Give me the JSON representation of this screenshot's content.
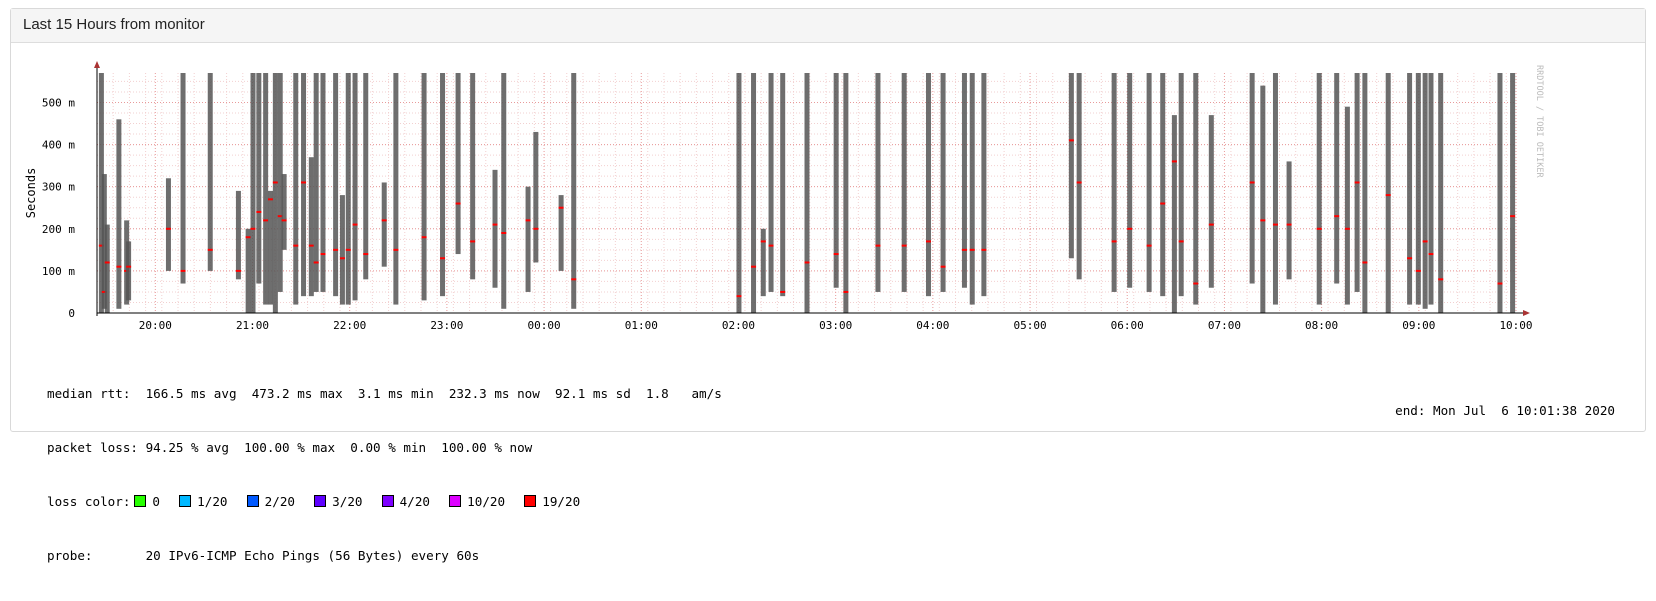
{
  "panel": {
    "title": "Last 15 Hours from monitor"
  },
  "chart_data": {
    "type": "bar",
    "ylabel": "Seconds",
    "watermark": "RRDTOOL / TOBI OETIKER",
    "y_ticks": [
      {
        "value": 0,
        "label": "0"
      },
      {
        "value": 0.1,
        "label": "100 m"
      },
      {
        "value": 0.2,
        "label": "200 m"
      },
      {
        "value": 0.3,
        "label": "300 m"
      },
      {
        "value": 0.4,
        "label": "400 m"
      },
      {
        "value": 0.5,
        "label": "500 m"
      }
    ],
    "ylim": [
      0,
      0.57
    ],
    "x_ticks": [
      "20:00",
      "21:00",
      "22:00",
      "23:00",
      "00:00",
      "01:00",
      "02:00",
      "03:00",
      "04:00",
      "05:00",
      "06:00",
      "07:00",
      "08:00",
      "09:00",
      "10:00"
    ],
    "x_tick_hours": [
      0.6,
      1.6,
      2.6,
      3.6,
      4.6,
      5.6,
      6.6,
      7.6,
      8.6,
      9.6,
      10.6,
      11.6,
      12.6,
      13.6,
      14.6
    ],
    "xlim_hours": [
      0,
      14.6
    ],
    "grid": true,
    "series": [
      {
        "name": "median rtt",
        "points": [
          [
            0.04,
            0.0,
            0.57,
            0.16
          ],
          [
            0.07,
            0.01,
            0.33,
            0.05
          ],
          [
            0.1,
            0.0,
            0.21,
            0.12
          ],
          [
            0.22,
            0.01,
            0.46,
            0.11
          ],
          [
            0.3,
            0.02,
            0.22,
            0.1
          ],
          [
            0.32,
            0.03,
            0.17,
            0.11
          ],
          [
            0.73,
            0.1,
            0.32,
            0.2
          ],
          [
            0.88,
            0.07,
            0.57,
            0.1
          ],
          [
            1.16,
            0.1,
            0.57,
            0.15
          ],
          [
            1.45,
            0.08,
            0.29,
            0.1
          ],
          [
            1.55,
            0.0,
            0.2,
            0.18
          ],
          [
            1.6,
            0.0,
            0.57,
            0.2
          ],
          [
            1.66,
            0.07,
            0.57,
            0.24
          ],
          [
            1.73,
            0.02,
            0.57,
            0.22
          ],
          [
            1.78,
            0.02,
            0.29,
            0.27
          ],
          [
            1.83,
            0.0,
            0.57,
            0.31
          ],
          [
            1.88,
            0.05,
            0.57,
            0.23
          ],
          [
            1.92,
            0.15,
            0.33,
            0.22
          ],
          [
            2.04,
            0.02,
            0.57,
            0.16
          ],
          [
            2.12,
            0.04,
            0.57,
            0.31
          ],
          [
            2.2,
            0.04,
            0.37,
            0.16
          ],
          [
            2.25,
            0.05,
            0.57,
            0.12
          ],
          [
            2.32,
            0.05,
            0.57,
            0.14
          ],
          [
            2.45,
            0.04,
            0.57,
            0.15
          ],
          [
            2.52,
            0.02,
            0.28,
            0.13
          ],
          [
            2.58,
            0.02,
            0.57,
            0.15
          ],
          [
            2.65,
            0.03,
            0.57,
            0.21
          ],
          [
            2.76,
            0.08,
            0.57,
            0.14
          ],
          [
            2.95,
            0.11,
            0.31,
            0.22
          ],
          [
            3.07,
            0.02,
            0.57,
            0.15
          ],
          [
            3.36,
            0.03,
            0.57,
            0.18
          ],
          [
            3.55,
            0.04,
            0.57,
            0.13
          ],
          [
            3.71,
            0.14,
            0.57,
            0.26
          ],
          [
            3.86,
            0.08,
            0.57,
            0.17
          ],
          [
            4.09,
            0.06,
            0.34,
            0.21
          ],
          [
            4.18,
            0.01,
            0.57,
            0.19
          ],
          [
            4.43,
            0.05,
            0.3,
            0.22
          ],
          [
            4.51,
            0.12,
            0.43,
            0.2
          ],
          [
            4.77,
            0.1,
            0.28,
            0.25
          ],
          [
            4.9,
            0.01,
            0.57,
            0.08
          ],
          [
            6.6,
            0.0,
            0.57,
            0.04
          ],
          [
            6.75,
            0.0,
            0.57,
            0.11
          ],
          [
            6.85,
            0.04,
            0.2,
            0.17
          ],
          [
            6.93,
            0.05,
            0.57,
            0.16
          ],
          [
            7.05,
            0.04,
            0.57,
            0.05
          ],
          [
            7.3,
            0.0,
            0.57,
            0.12
          ],
          [
            7.6,
            0.06,
            0.57,
            0.14
          ],
          [
            7.7,
            0.0,
            0.57,
            0.05
          ],
          [
            8.03,
            0.05,
            0.57,
            0.16
          ],
          [
            8.3,
            0.05,
            0.57,
            0.16
          ],
          [
            8.55,
            0.04,
            0.57,
            0.17
          ],
          [
            8.7,
            0.05,
            0.57,
            0.11
          ],
          [
            8.92,
            0.06,
            0.57,
            0.15
          ],
          [
            9.0,
            0.02,
            0.57,
            0.15
          ],
          [
            9.12,
            0.04,
            0.57,
            0.15
          ],
          [
            10.02,
            0.13,
            0.57,
            0.41
          ],
          [
            10.1,
            0.08,
            0.57,
            0.31
          ],
          [
            10.46,
            0.05,
            0.57,
            0.17
          ],
          [
            10.62,
            0.06,
            0.57,
            0.2
          ],
          [
            10.82,
            0.05,
            0.57,
            0.16
          ],
          [
            10.96,
            0.04,
            0.57,
            0.26
          ],
          [
            11.08,
            0.0,
            0.47,
            0.36
          ],
          [
            11.15,
            0.04,
            0.57,
            0.17
          ],
          [
            11.3,
            0.02,
            0.57,
            0.07
          ],
          [
            11.46,
            0.06,
            0.47,
            0.21
          ],
          [
            11.88,
            0.07,
            0.57,
            0.31
          ],
          [
            11.99,
            0.0,
            0.54,
            0.22
          ],
          [
            12.12,
            0.02,
            0.57,
            0.21
          ],
          [
            12.26,
            0.08,
            0.36,
            0.21
          ],
          [
            12.57,
            0.02,
            0.57,
            0.2
          ],
          [
            12.75,
            0.07,
            0.57,
            0.23
          ],
          [
            12.86,
            0.02,
            0.49,
            0.2
          ],
          [
            12.96,
            0.05,
            0.57,
            0.31
          ],
          [
            13.04,
            0.0,
            0.57,
            0.12
          ],
          [
            13.28,
            0.0,
            0.57,
            0.28
          ],
          [
            13.5,
            0.02,
            0.57,
            0.13
          ],
          [
            13.59,
            0.02,
            0.57,
            0.1
          ],
          [
            13.66,
            0.01,
            0.57,
            0.17
          ],
          [
            13.72,
            0.02,
            0.57,
            0.14
          ],
          [
            13.82,
            0.0,
            0.57,
            0.08
          ],
          [
            14.43,
            0.0,
            0.57,
            0.07
          ],
          [
            14.56,
            0.0,
            0.57,
            0.23
          ]
        ]
      }
    ]
  },
  "legend": {
    "rtt_line": "median rtt:  166.5 ms avg  473.2 ms max  3.1 ms min  232.3 ms now  92.1 ms sd  1.8   am/s",
    "loss_line": "packet loss: 94.25 % avg  100.00 % max  0.00 % min  100.00 % now",
    "loss_color_label": "loss color:",
    "loss_items": [
      {
        "label": "0",
        "color": "#26ff00"
      },
      {
        "label": "1/20",
        "color": "#00b8ff"
      },
      {
        "label": "2/20",
        "color": "#0059ff"
      },
      {
        "label": "3/20",
        "color": "#5e00ff"
      },
      {
        "label": "4/20",
        "color": "#7e00ff"
      },
      {
        "label": "10/20",
        "color": "#dd00ff"
      },
      {
        "label": "19/20",
        "color": "#ff0000"
      }
    ],
    "probe_label": "probe:",
    "probe_value": "20 IPv6-ICMP Echo Pings (56 Bytes) every 60s",
    "end_text": "end: Mon Jul  6 10:01:38 2020"
  }
}
